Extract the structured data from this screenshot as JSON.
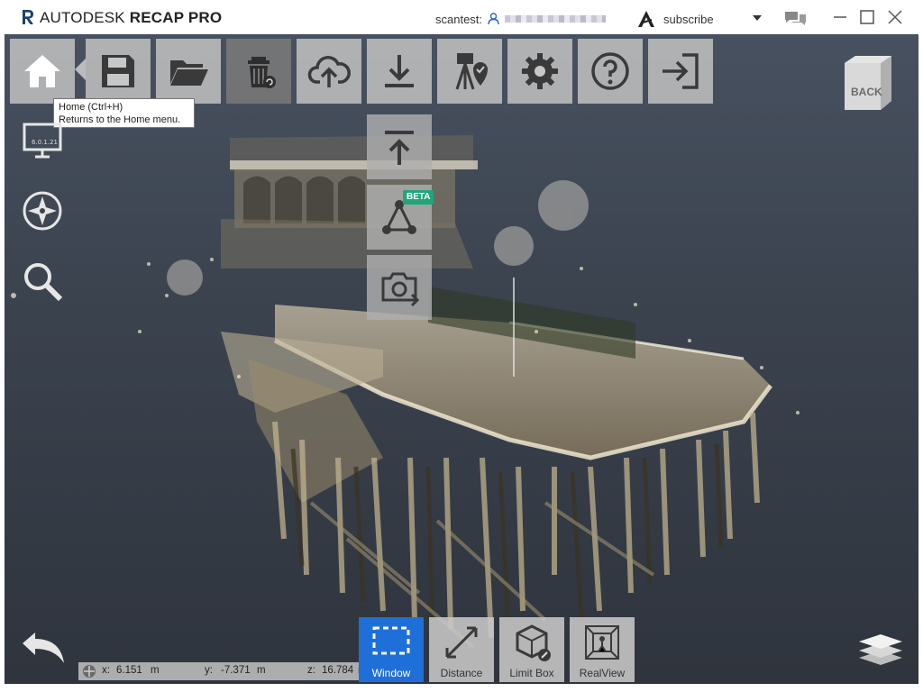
{
  "app": {
    "brand": "AUTODESK",
    "product": "RECAP PRO",
    "accent_color": "#1f6fd8",
    "brand_red": "#1a3c6e"
  },
  "titlebar": {
    "user_label": "scantest:",
    "subscribe_label": "subscribe",
    "icons": [
      "user-icon",
      "autodesk-a-icon",
      "chevron-down-icon",
      "chat-icon",
      "minimize-icon",
      "maximize-icon",
      "close-icon"
    ]
  },
  "toolbar": {
    "buttons": [
      {
        "name": "home",
        "icon": "home-icon"
      },
      {
        "name": "save",
        "icon": "save-icon"
      },
      {
        "name": "open",
        "icon": "folder-open-icon"
      },
      {
        "name": "recycle",
        "icon": "trash-restore-icon"
      },
      {
        "name": "upload",
        "icon": "cloud-upload-icon"
      },
      {
        "name": "export",
        "icon": "download-icon"
      },
      {
        "name": "survey",
        "icon": "survey-point-icon"
      },
      {
        "name": "settings",
        "icon": "gear-icon"
      },
      {
        "name": "help",
        "icon": "help-icon"
      },
      {
        "name": "exit",
        "icon": "exit-icon"
      }
    ],
    "tooltip_title": "Home (Ctrl+H)",
    "tooltip_desc": "Returns to the Home menu."
  },
  "export_dropdown": {
    "items": [
      {
        "name": "export-upload",
        "icon": "upload-arrow-icon"
      },
      {
        "name": "export-mesh",
        "icon": "mesh-triangle-icon",
        "badge": "BETA"
      },
      {
        "name": "export-snapshot",
        "icon": "camera-export-icon"
      }
    ],
    "badge_color": "#21a67a"
  },
  "left_nav": {
    "version": "6.0.1.21",
    "icons": [
      "display-icon",
      "compass-icon",
      "search-icon"
    ]
  },
  "viewcube": {
    "label": "BACK"
  },
  "coords": {
    "x_label": "x:",
    "x_value": "6.151",
    "x_unit": "m",
    "y_label": "y:",
    "y_value": "-7.371",
    "y_unit": "m",
    "z_label": "z:",
    "z_value": "16.784",
    "z_unit": "m"
  },
  "bottom_tools": [
    {
      "label": "Window",
      "icon": "window-select-icon",
      "active": true
    },
    {
      "label": "Distance",
      "icon": "distance-icon",
      "active": false
    },
    {
      "label": "Limit Box",
      "icon": "limit-box-icon",
      "active": false
    },
    {
      "label": "RealView",
      "icon": "realview-icon",
      "active": false
    }
  ]
}
